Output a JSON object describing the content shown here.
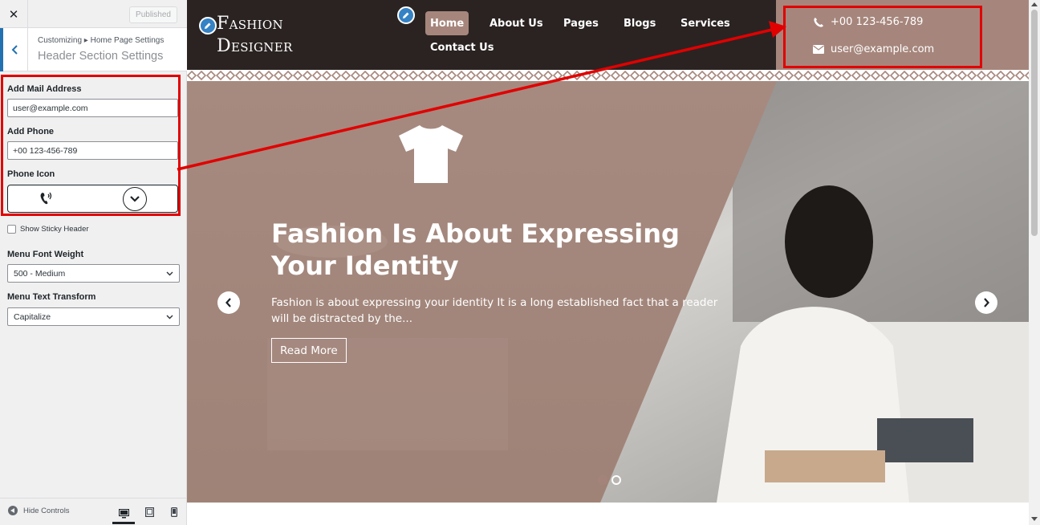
{
  "sidebar": {
    "close_label": "✕",
    "published_label": "Published",
    "breadcrumb": "Customizing ▸ Home Page Settings",
    "section_title": "Header Section Settings",
    "mail_label": "Add Mail Address",
    "mail_value": "user@example.com",
    "phone_label": "Add Phone",
    "phone_value": "+00 123-456-789",
    "phone_icon_label": "Phone Icon",
    "sticky_label": "Show Sticky Header",
    "font_weight_label": "Menu Font Weight",
    "font_weight_value": "500 - Medium",
    "text_transform_label": "Menu Text Transform",
    "text_transform_value": "Capitalize",
    "hide_controls_label": "Hide Controls"
  },
  "site": {
    "logo_line1": "Fashion",
    "logo_line2": "Designer",
    "nav": {
      "home": "Home",
      "about": "About Us",
      "pages": "Pages",
      "blogs": "Blogs",
      "services": "Services",
      "contact": "Contact Us"
    },
    "contact": {
      "phone": "+00 123-456-789",
      "email": "user@example.com"
    },
    "hero": {
      "title": "Fashion Is About Expressing Your Identity",
      "description": "Fashion is about expressing your identity It is a long established fact that a reader will be distracted by the...",
      "button": "Read More"
    }
  },
  "colors": {
    "header_bg": "#2a2322",
    "accent": "#a6867c",
    "annotation": "#e10000",
    "wp_blue": "#2271b1"
  }
}
